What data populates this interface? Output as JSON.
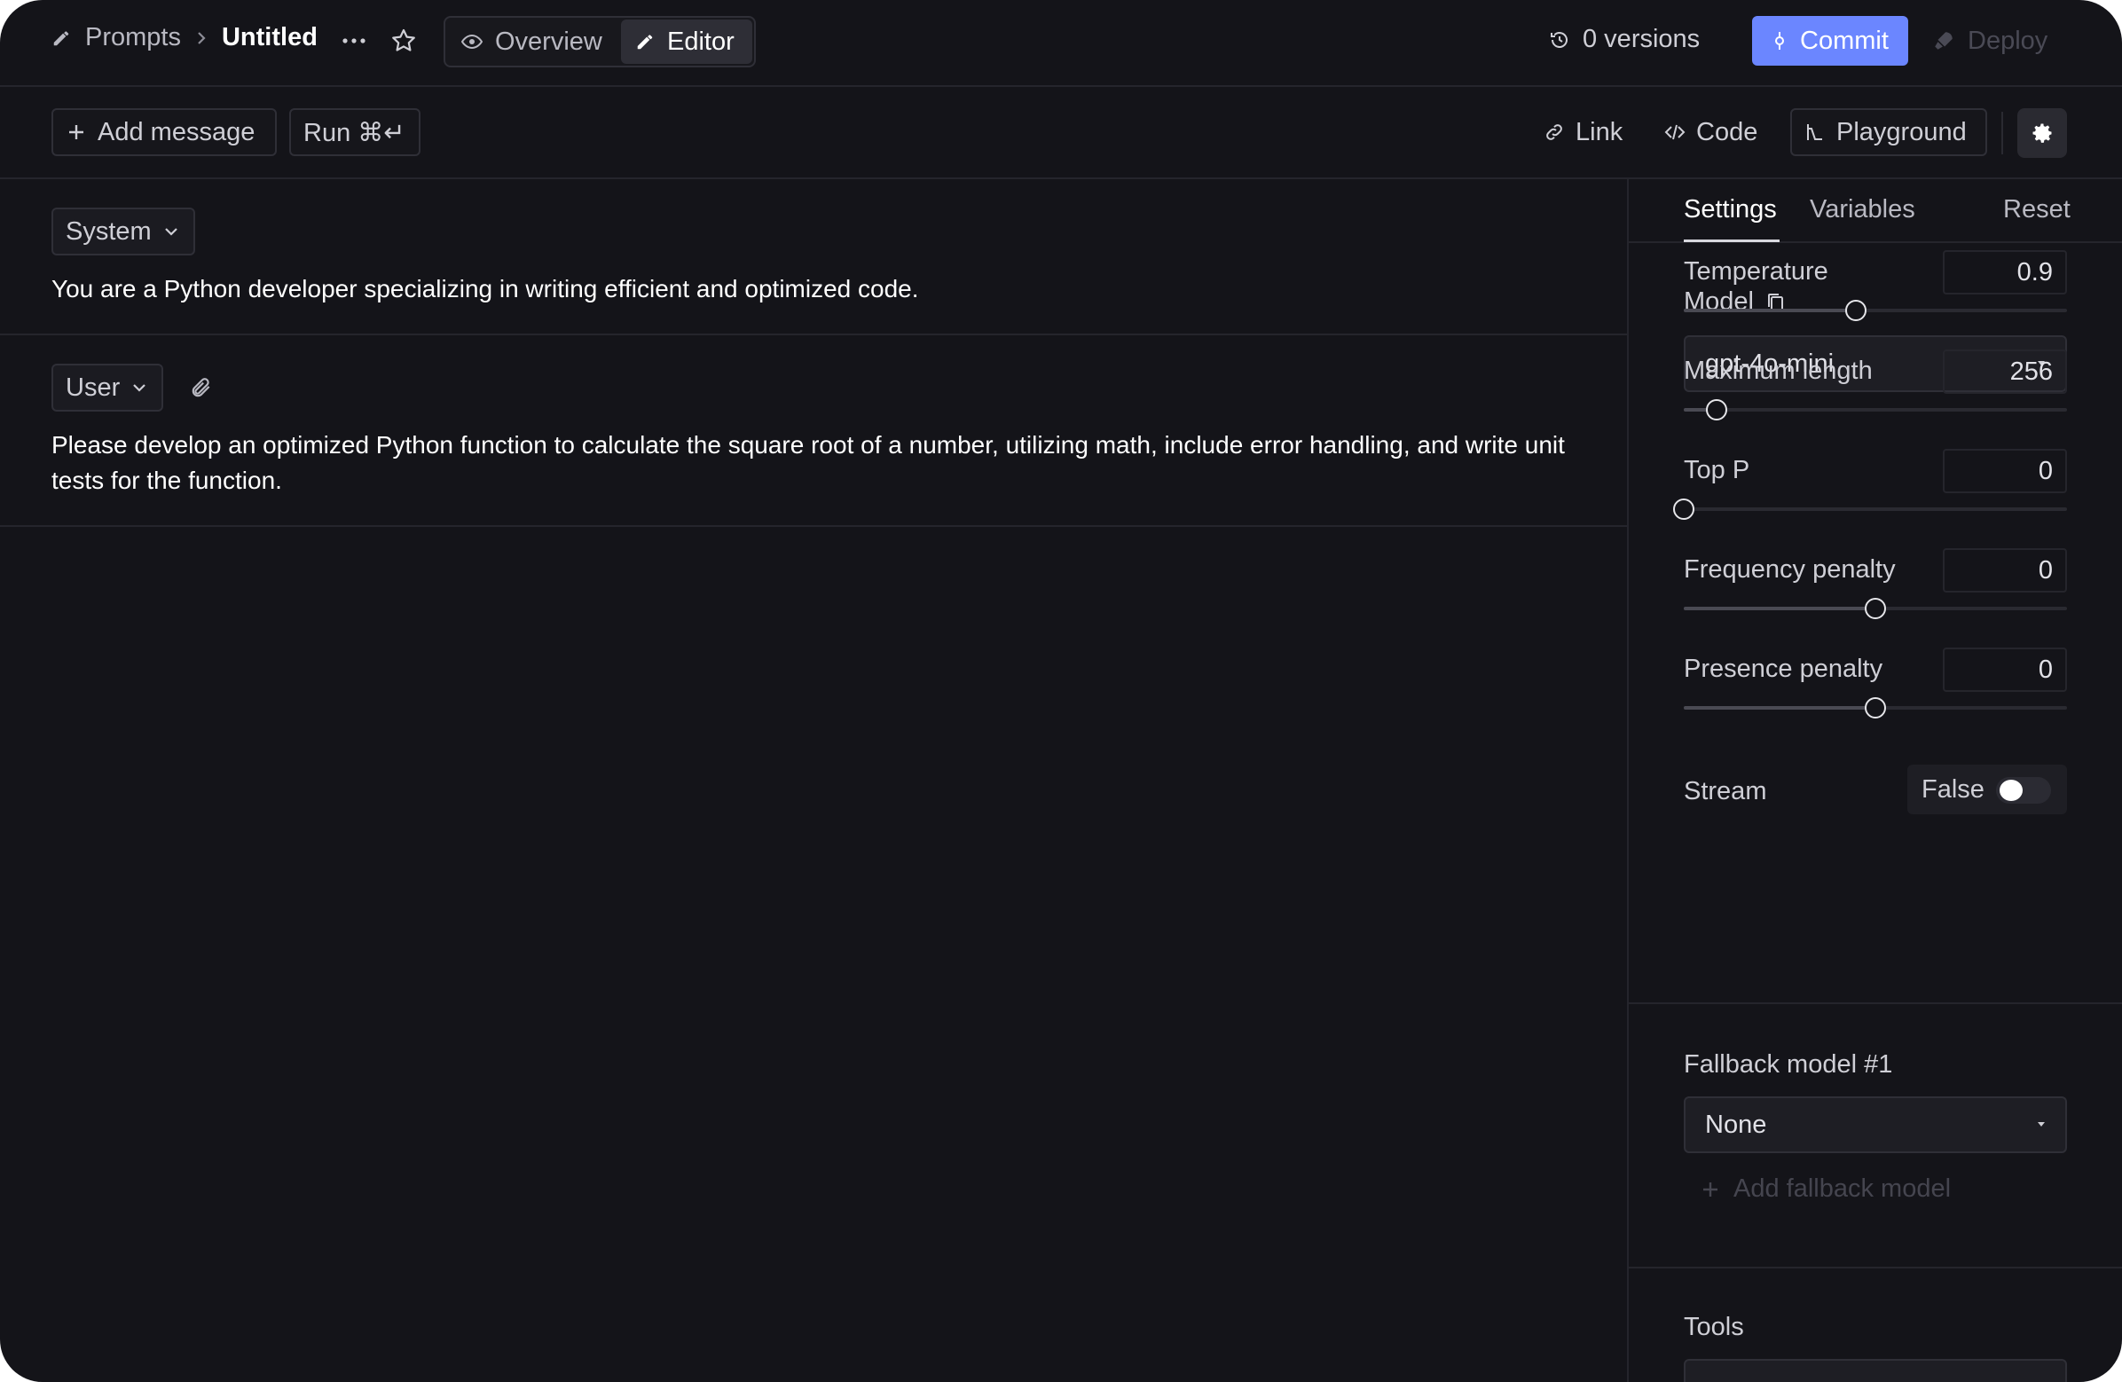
{
  "header": {
    "breadcrumb_parent": "Prompts",
    "breadcrumb_current": "Untitled",
    "more_icon": "more-horizontal-icon",
    "favorite_icon": "star-icon",
    "tabs": {
      "overview": "Overview",
      "editor": "Editor"
    },
    "versions": "0 versions",
    "commit_label": "Commit",
    "deploy_label": "Deploy",
    "accent_color": "#6b86ff"
  },
  "toolbar": {
    "add_message": "Add message",
    "run": "Run ⌘↵",
    "link": "Link",
    "code": "Code",
    "playground": "Playground",
    "settings_icon": "gear-icon"
  },
  "messages": [
    {
      "role": "System",
      "content": "You are a Python developer specializing in writing efficient and optimized code."
    },
    {
      "role": "User",
      "content": "Please develop an optimized Python function to calculate the square root of a number, utilizing math, include error handling, and write unit tests for the function.",
      "attach_icon": "paperclip-icon"
    }
  ],
  "sidebar": {
    "tabs": {
      "settings": "Settings",
      "variables": "Variables",
      "reset": "Reset"
    },
    "model_label": "Model",
    "model_value": "gpt-4o-mini",
    "params": [
      {
        "label": "Temperature",
        "value": "0.9",
        "fraction": 0.45
      },
      {
        "label": "Maximum length",
        "value": "256",
        "fraction": 0.085
      },
      {
        "label": "Top P",
        "value": "0",
        "fraction": 0.0
      },
      {
        "label": "Frequency penalty",
        "value": "0",
        "fraction": 0.5
      },
      {
        "label": "Presence penalty",
        "value": "0",
        "fraction": 0.5
      }
    ],
    "stream_label": "Stream",
    "stream_value": "False",
    "fallback_label": "Fallback model #1",
    "fallback_value": "None",
    "add_fallback": "Add fallback model",
    "tools_label": "Tools"
  }
}
